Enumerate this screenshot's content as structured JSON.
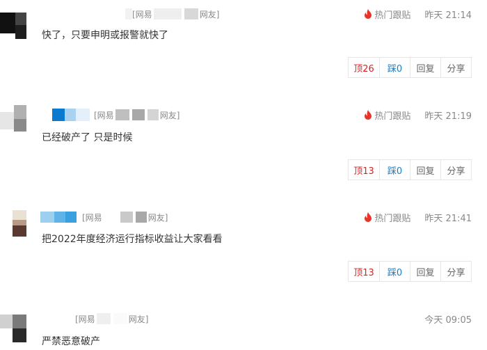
{
  "comments": [
    {
      "user_prefix": "[网易",
      "user_suffix": "网友]",
      "hot_label": "热门跟贴",
      "time": "昨天 21:14",
      "content": "快了，只要申明或报警就快了",
      "up_label": "顶26",
      "down_label": "踩0",
      "reply_label": "回复",
      "share_label": "分享"
    },
    {
      "user_prefix": "[网易",
      "user_suffix": "网友]",
      "hot_label": "热门跟贴",
      "time": "昨天 21:19",
      "content": "已经破产了 只是时候",
      "up_label": "顶13",
      "down_label": "踩0",
      "reply_label": "回复",
      "share_label": "分享"
    },
    {
      "user_prefix": "[网易",
      "user_suffix": "网友]",
      "hot_label": "热门跟贴",
      "time": "昨天 21:41",
      "content": "把2022年度经济运行指标收益让大家看看",
      "up_label": "顶13",
      "down_label": "踩0",
      "reply_label": "回复",
      "share_label": "分享"
    },
    {
      "user_prefix": "[网易",
      "user_suffix": "网友]",
      "time": "今天 09:05",
      "content": "严禁恶意破产"
    }
  ],
  "colors": {
    "hot_flame": "#e8352b",
    "up": "#e02020",
    "down": "#1a7cc5"
  }
}
